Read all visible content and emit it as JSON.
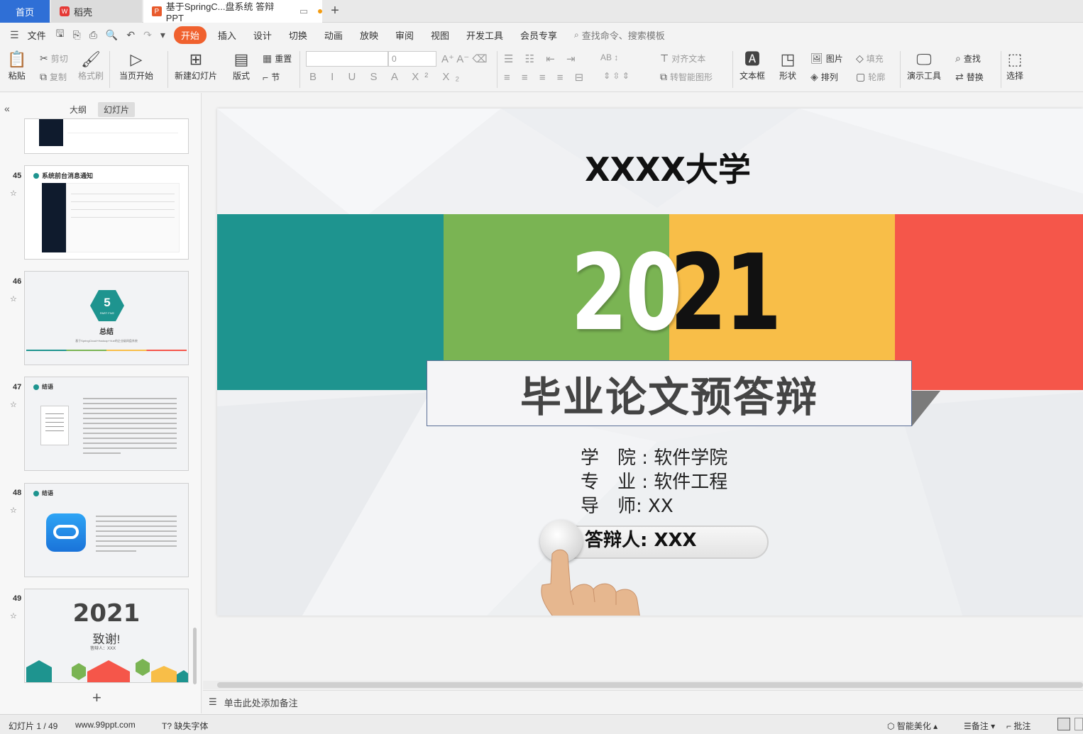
{
  "tabs": {
    "home": "首页",
    "daoke": "稻壳",
    "document": "基于SpringC...盘系统 答辩PPT"
  },
  "menu": {
    "file": "文件",
    "items": [
      "开始",
      "插入",
      "设计",
      "切换",
      "动画",
      "放映",
      "审阅",
      "视图",
      "开发工具",
      "会员专享"
    ],
    "search": "查找命令、搜索模板"
  },
  "ribbon": {
    "paste": "粘贴",
    "cut": "剪切",
    "copy": "复制",
    "format_painter": "格式刷",
    "from_current": "当页开始",
    "new_slide": "新建幻灯片",
    "layout": "版式",
    "reset": "重置",
    "section": "节",
    "font_size": "0",
    "align_text": "对齐文本",
    "smart_shape": "转智能图形",
    "textbox": "文本框",
    "shape": "形状",
    "picture": "图片",
    "arrange": "排列",
    "fill": "填充",
    "outline": "轮廓",
    "present_tool": "演示工具",
    "find": "查找",
    "replace": "替换",
    "select": "选择"
  },
  "panel": {
    "outline_tab": "大纲",
    "slides_tab": "幻灯片",
    "thumbs": [
      {
        "num": "45",
        "heading": "系统前台消息通知"
      },
      {
        "num": "46",
        "hex_number": "5",
        "hex_sub": "PART FIVE",
        "heading": "总结",
        "caption": "基于SpringCloud+Hadoop+Vue的企业级网盘系统"
      },
      {
        "num": "47",
        "heading": "结语"
      },
      {
        "num": "48",
        "heading": "结语"
      },
      {
        "num": "49",
        "year": "2021",
        "thanks": "致谢!",
        "defender": "答辩人：XXX"
      }
    ]
  },
  "slide": {
    "university": "XXXX大学",
    "year_white": "20",
    "year_black": "21",
    "title": "毕业论文预答辩",
    "college": "学　院 : 软件学院",
    "major": "专　业 : 软件工程",
    "advisor": "导　师:  XX",
    "defender": "答辩人:  XXX",
    "colors": {
      "teal": "#1e948f",
      "green": "#7ab453",
      "yellow": "#f8be48",
      "red": "#f5564a"
    }
  },
  "notes": {
    "placeholder": "单击此处添加备注"
  },
  "status": {
    "slide_counter": "幻灯片 1 / 49",
    "website": "www.99ppt.com",
    "missing_font": "缺失字体",
    "beautify": "智能美化",
    "notes": "备注",
    "comments": "批注"
  }
}
